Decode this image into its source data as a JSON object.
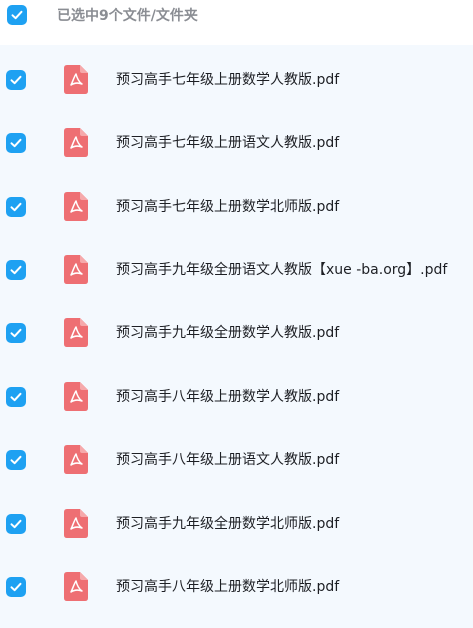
{
  "header": {
    "title": "已选中9个文件/文件夹"
  },
  "files": [
    {
      "name": "预习高手七年级上册数学人教版.pdf"
    },
    {
      "name": "预习高手七年级上册语文人教版.pdf"
    },
    {
      "name": "预习高手七年级上册数学北师版.pdf"
    },
    {
      "name": "预习高手九年级全册语文人教版【xue -ba.org】.pdf"
    },
    {
      "name": "预习高手九年级全册数学人教版.pdf"
    },
    {
      "name": "预习高手八年级上册数学人教版.pdf"
    },
    {
      "name": "预习高手八年级上册语文人教版.pdf"
    },
    {
      "name": "预习高手九年级全册数学北师版.pdf"
    },
    {
      "name": "预习高手八年级上册数学北师版.pdf"
    }
  ],
  "icons": {
    "checkbox": "checkbox-checked-icon",
    "file": "pdf-file-icon"
  },
  "colors": {
    "accent": "#1ea1f2",
    "pdf": "#ee6f73",
    "list_background": "#f4f9fe"
  }
}
